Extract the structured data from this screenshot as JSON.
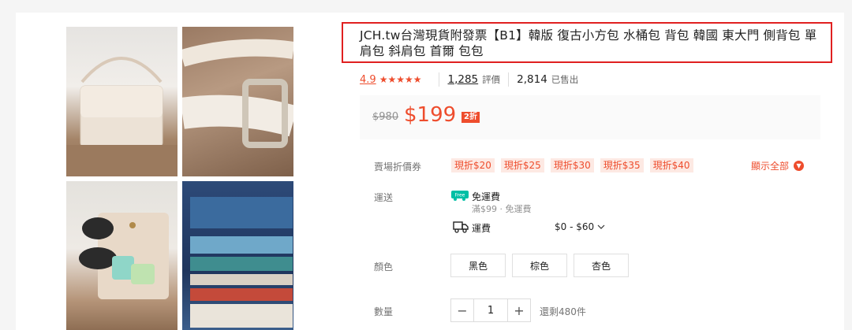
{
  "product": {
    "title": "JCH.tw台灣現貨附發票【B1】韓版 復古小方包 水桶包 背包 韓國 東大門 側背包 單肩包 斜肩包 首爾 包包"
  },
  "rating": {
    "value": "4.9",
    "stars": "★★★★★",
    "stars_count": 5,
    "reviews_count": "1,285",
    "reviews_label": "評價",
    "sold_count": "2,814",
    "sold_label": "已售出"
  },
  "price": {
    "original": "$980",
    "current": "$199",
    "discount": "2折"
  },
  "vouchers": {
    "label": "賣場折價券",
    "items": [
      "現折$20",
      "現折$25",
      "現折$30",
      "現折$35",
      "現折$40"
    ],
    "show_all": "顯示全部"
  },
  "shipping": {
    "label": "運送",
    "badge": "Free",
    "free_title": "免運費",
    "free_condition": "滿$99 · 免運費",
    "fee_label": "運費",
    "fee_range": "$0 - $60"
  },
  "color": {
    "label": "顏色",
    "options": [
      "黑色",
      "棕色",
      "杏色"
    ]
  },
  "quantity": {
    "label": "數量",
    "value": "1",
    "minus": "−",
    "plus": "+",
    "stock": "還剩480件"
  },
  "colors": {
    "accent": "#ee4d2d",
    "highlight_border": "#e02020",
    "free_green": "#00bfa5"
  }
}
